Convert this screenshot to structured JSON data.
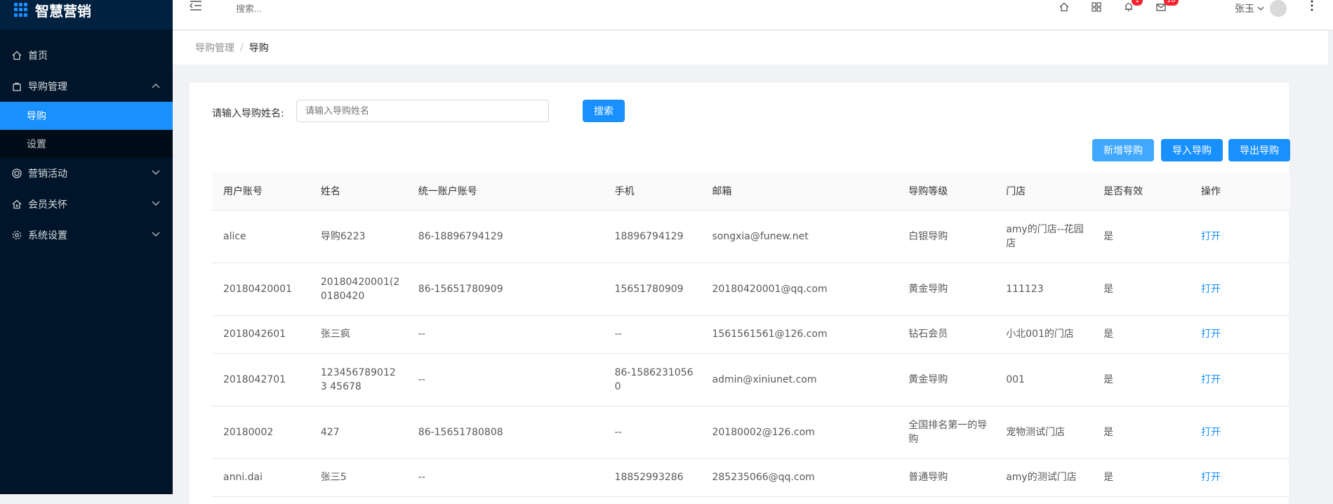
{
  "app": {
    "logo_text": "智慧营销"
  },
  "sidebar": {
    "items": [
      {
        "label": "首页",
        "icon": "home-icon"
      },
      {
        "label": "导购管理",
        "icon": "bag-icon",
        "expanded": true,
        "children": [
          {
            "label": "导购",
            "active": true
          },
          {
            "label": "设置"
          }
        ]
      },
      {
        "label": "营销活动",
        "icon": "target-icon"
      },
      {
        "label": "会员关怀",
        "icon": "home-heart-icon"
      },
      {
        "label": "系统设置",
        "icon": "gear-icon"
      }
    ]
  },
  "header": {
    "search_placeholder": "搜索...",
    "notifications_badge": "1",
    "messages_badge": "10",
    "user_name": "张玉"
  },
  "breadcrumb": {
    "parent": "导购管理",
    "current": "导购"
  },
  "filter": {
    "label": "请输入导购姓名:",
    "placeholder": "请输入导购姓名",
    "search_button": "搜索"
  },
  "actions": {
    "add": "新增导购",
    "import": "导入导购",
    "export": "导出导购"
  },
  "table": {
    "columns": [
      "用户账号",
      "姓名",
      "统一账户账号",
      "手机",
      "邮箱",
      "导购等级",
      "门店",
      "是否有效",
      "操作"
    ],
    "rows": [
      [
        "alice",
        "导购6223",
        "86-18896794129",
        "18896794129",
        "songxia@funew.net",
        "白银导购",
        "amy的门店--花园店",
        "是",
        "打开"
      ],
      [
        "20180420001",
        "20180420001(20180420",
        "86-15651780909",
        "15651780909",
        "20180420001@qq.com",
        "黄金导购",
        "111123",
        "是",
        "打开"
      ],
      [
        "2018042601",
        "张三疯",
        "--",
        "--",
        "1561561561@126.com",
        "钻石会员",
        "小北001的门店",
        "是",
        "打开"
      ],
      [
        "2018042701",
        "1234567890123 45678",
        "--",
        "86-15862310560",
        "admin@xiniunet.com",
        "黄金导购",
        "001",
        "是",
        "打开"
      ],
      [
        "20180002",
        "427",
        "86-15651780808",
        "--",
        "20180002@126.com",
        "全国排名第一的导购",
        "宠物测试门店",
        "是",
        "打开"
      ],
      [
        "anni.dai",
        "张三5",
        "--",
        "18852993286",
        "285235066@qq.com",
        "普通导购",
        "amy的测试门店",
        "是",
        "打开"
      ]
    ]
  },
  "colors": {
    "sidebar_bg": "#001529",
    "active": "#1890ff",
    "link": "#1890ff"
  }
}
